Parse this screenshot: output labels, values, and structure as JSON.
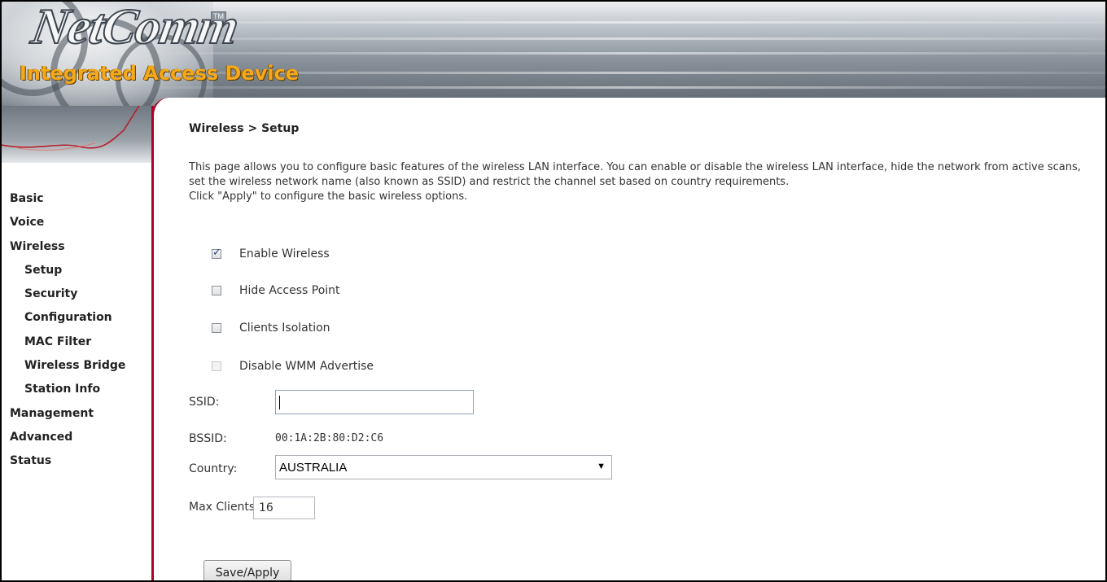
{
  "header": {
    "brand": "NetComm",
    "trademark": "TM",
    "subtitle": "Integrated Access Device",
    "colors": {
      "subtitle": "#f5a81a",
      "rule": "#b3002a"
    }
  },
  "sidebar": {
    "items": [
      {
        "label": "Basic"
      },
      {
        "label": "Voice"
      },
      {
        "label": "Wireless"
      },
      {
        "label": "Setup"
      },
      {
        "label": "Security"
      },
      {
        "label": "Configuration"
      },
      {
        "label": "MAC Filter"
      },
      {
        "label": "Wireless Bridge"
      },
      {
        "label": "Station Info"
      },
      {
        "label": "Management"
      },
      {
        "label": "Advanced"
      },
      {
        "label": "Status"
      }
    ]
  },
  "page": {
    "breadcrumb": "Wireless > Setup",
    "description_1": "This page allows you to configure basic features of the wireless LAN interface. You can enable or disable the wireless LAN interface, hide the network from active scans, set the wireless network name (also known as SSID) and restrict the channel set based on country requirements.",
    "description_2": "Click \"Apply\" to configure the basic wireless options."
  },
  "form": {
    "enable_wireless": {
      "label": "Enable Wireless",
      "checked": true
    },
    "hide_access_point": {
      "label": "Hide Access Point",
      "checked": false
    },
    "clients_isolation": {
      "label": "Clients Isolation",
      "checked": false
    },
    "disable_wmm": {
      "label": "Disable WMM Advertise",
      "checked": false,
      "disabled": true
    },
    "ssid": {
      "label": "SSID:",
      "value": ""
    },
    "bssid": {
      "label": "BSSID:",
      "value": "00:1A:2B:80:D2:C6"
    },
    "country": {
      "label": "Country:",
      "value": "AUSTRALIA"
    },
    "max_clients": {
      "label": "Max Clients:",
      "value": "16"
    },
    "apply_label": "Save/Apply"
  }
}
